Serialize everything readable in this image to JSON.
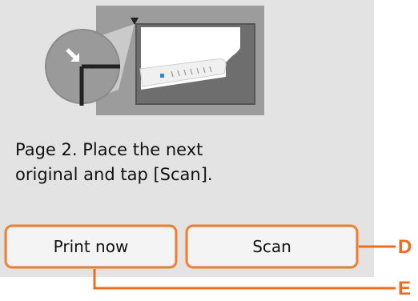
{
  "screen": {
    "message": "Page 2. Place the next\noriginal and tap [Scan].",
    "buttons": {
      "print_now": "Print now",
      "scan": "Scan"
    }
  },
  "callouts": {
    "d": "D",
    "e": "E"
  },
  "colors": {
    "panel_background": "#e3e3e3",
    "callout_orange": "#f26a1b",
    "button_highlight": "#ff7a1e"
  },
  "illustration": {
    "icons": [
      "scanner-platen-icon",
      "document-corner-magnifier-icon",
      "alignment-arrow-icon"
    ]
  }
}
